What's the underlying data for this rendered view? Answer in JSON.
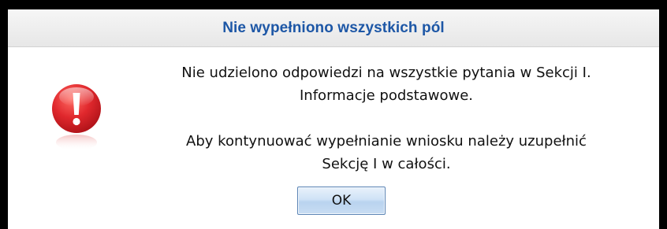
{
  "dialog": {
    "title": "Nie wypełniono wszystkich pól",
    "icon": "error-exclamation-icon",
    "message_1_line_1": "Nie udzielono odpowiedzi na wszystkie pytania w Sekcji I.",
    "message_1_line_2": "Informacje podstawowe.",
    "message_2_line_1": "Aby kontynuować wypełnianie wniosku należy uzupełnić",
    "message_2_line_2": "Sekcję I w całości.",
    "ok_label": "OK"
  },
  "colors": {
    "title_text": "#1d57a6",
    "icon_red": "#d8262b",
    "button_border": "#5b84b5"
  }
}
